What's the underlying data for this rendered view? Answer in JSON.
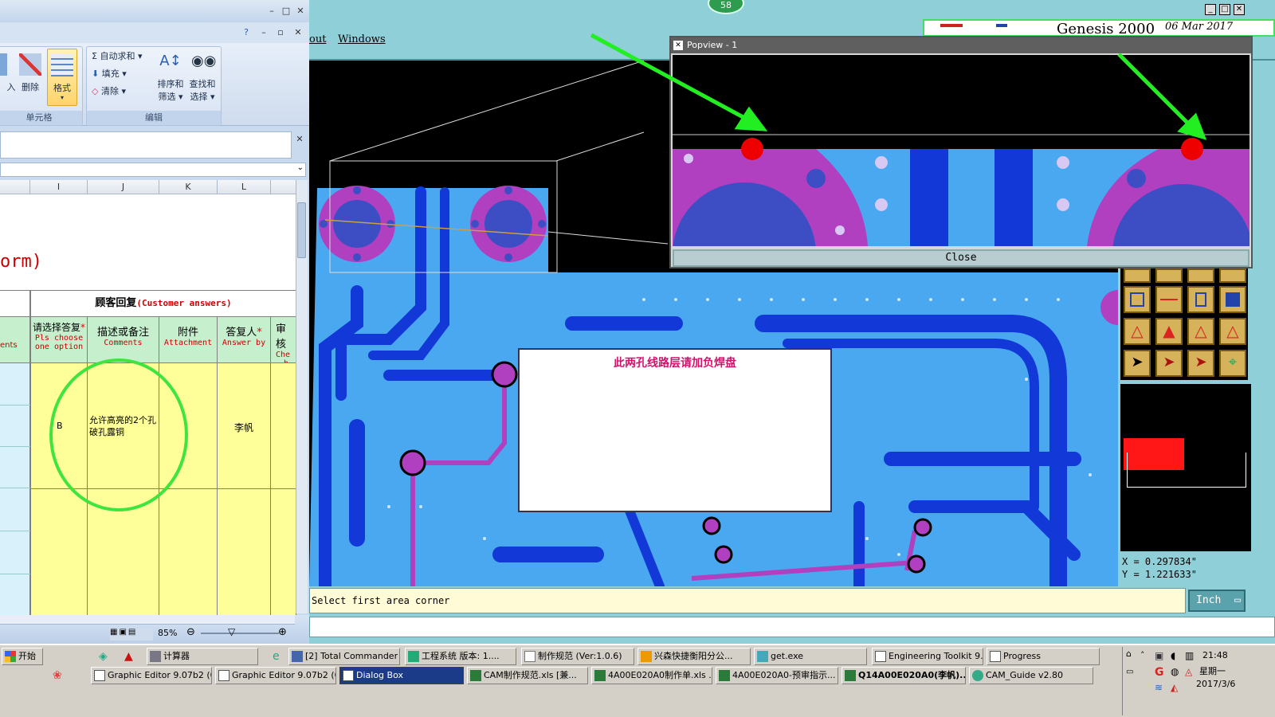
{
  "excel": {
    "ribbon": {
      "insert_label": "入",
      "delete_label": "删除",
      "format_label": "格式",
      "cells_group": "单元格",
      "autosum": "自动求和",
      "fill": "填充",
      "clear": "清除",
      "sort_filter_1": "排序和",
      "sort_filter_2": "筛选",
      "find_select_1": "查找和",
      "find_select_2": "选择",
      "edit_group": "编辑"
    },
    "columns": [
      "I",
      "J",
      "K",
      "L"
    ],
    "sheet": {
      "title_fragment": "orm)",
      "customer_answers_cn": "顾客回复",
      "customer_answers_en": "(Customer answers)",
      "left_fragment": "ents",
      "headers": [
        {
          "cn": "请选择答复",
          "en1": "Pls choose",
          "en2": "one option",
          "required": true
        },
        {
          "cn": "描述或备注",
          "en1": "Comments",
          "en2": "",
          "required": false
        },
        {
          "cn": "附件",
          "en1": "Attachment",
          "en2": "",
          "required": false
        },
        {
          "cn": "答复人",
          "en1": "Answer by",
          "en2": "",
          "required": true
        },
        {
          "cn": "审核",
          "en1": "Che",
          "en2": "b",
          "required": false
        }
      ],
      "row": {
        "option": "B",
        "comment": "允许高亮的2个孔破孔露铜",
        "answer_by": "李帆"
      }
    },
    "zoom": "85%"
  },
  "genesis": {
    "badge": "58",
    "menu": [
      "out",
      "Windows"
    ],
    "app_title": "Genesis 2000",
    "date": "06 Mar 2017",
    "popview": {
      "title": "Popview - 1",
      "close_label": "Close"
    },
    "dialog_message": "此两孔线路层请加负焊盘",
    "coords": {
      "x_label": "X",
      "x_value": "0.297834\"",
      "y_label": "Y",
      "y_value": "1.221633\""
    },
    "status": "Select first area corner",
    "unit": "Inch"
  },
  "taskbar": {
    "start": "开始",
    "row1": [
      "计算器",
      "[2] Total Commander ...",
      "工程系统  版本: 1....",
      "制作规范 (Ver:1.0.6)",
      "兴森快捷衡阳分公...",
      "get.exe",
      "Engineering Toolkit 9....",
      "Progress"
    ],
    "row2": [
      "Graphic Editor 9.07b2 (0...",
      "Graphic Editor 9.07b2 (0...",
      "Dialog Box",
      "CAM制作规范.xls [兼...",
      "4A00E020A0制作单.xls ...",
      "4A00E020A0-预审指示...",
      "Q14A00E020A0(李帆)...",
      "CAM_Guide v2.80"
    ],
    "time": "21:48",
    "weekday": "星期一",
    "date": "2017/3/6"
  },
  "colors": {
    "board_blue": "#4aa8f0",
    "trace_blue": "#1238d8",
    "pad_magenta": "#b040c0",
    "annotation_green": "#22ee22",
    "dialog_text": "#d0146e"
  }
}
